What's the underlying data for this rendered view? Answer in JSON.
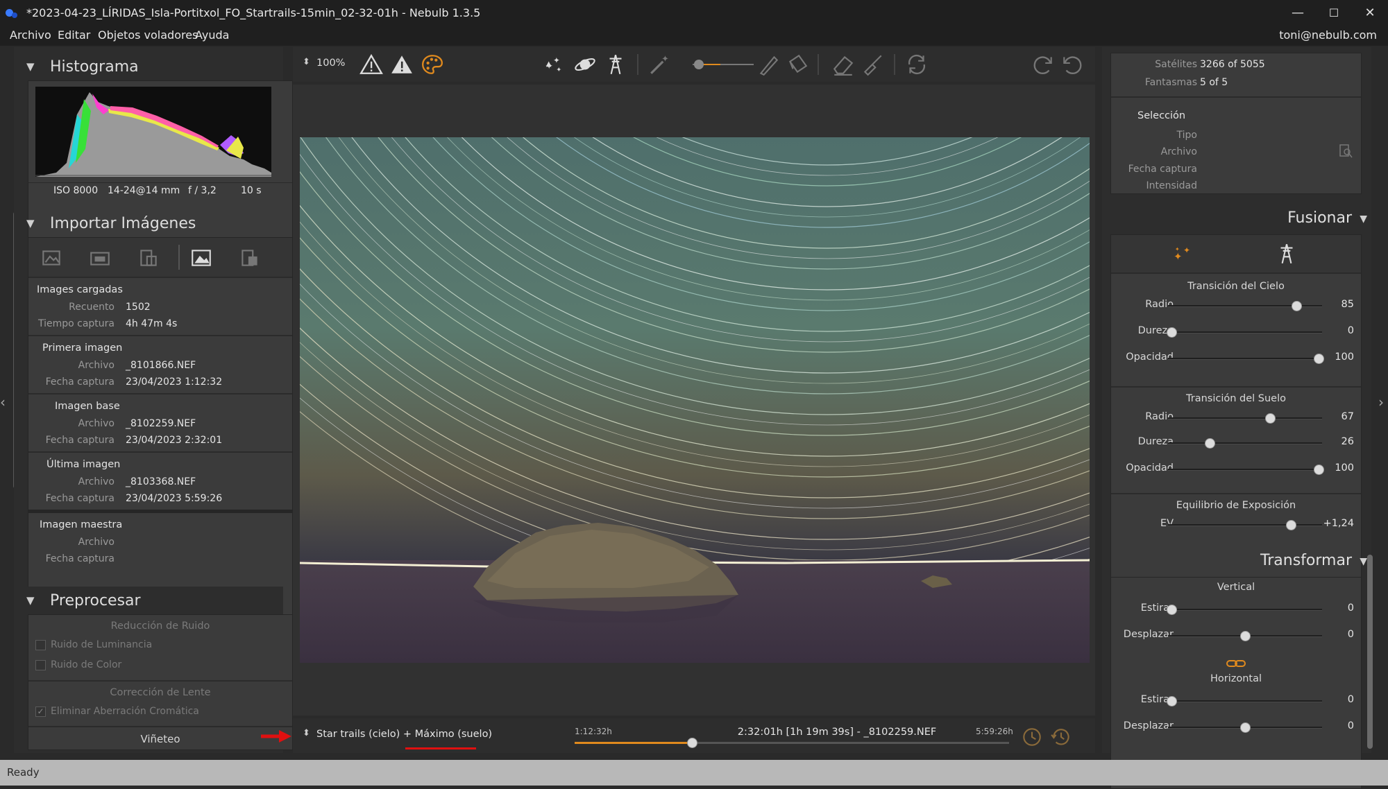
{
  "window": {
    "title": "*2023-04-23_LÍRIDAS_Isla-Portitxol_FO_Startrails-15min_02-32-01h - Nebulb 1.3.5",
    "controls": [
      "—",
      "☐",
      "✕"
    ]
  },
  "menubar": {
    "items": [
      "Archivo",
      "Editar",
      "Objetos voladores",
      "Ayuda"
    ],
    "user": "toni@nebulb.com"
  },
  "histogram": {
    "title": "Histograma",
    "iso": "ISO 8000",
    "lens": "14-24@14 mm",
    "aperture": "f / 3,2",
    "exposure": "10 s"
  },
  "import": {
    "title": "Importar Imágenes",
    "loaded": {
      "heading": "Images cargadas",
      "count_label": "Recuento",
      "count": "1502",
      "time_label": "Tiempo captura",
      "time": "4h 47m 4s"
    },
    "first": {
      "heading": "Primera imagen",
      "file_label": "Archivo",
      "file": "_8101866.NEF",
      "date_label": "Fecha captura",
      "date": "23/04/2023 1:12:32"
    },
    "base": {
      "heading": "Imagen base",
      "file_label": "Archivo",
      "file": "_8102259.NEF",
      "date_label": "Fecha captura",
      "date": "23/04/2023 2:32:01"
    },
    "last": {
      "heading": "Última imagen",
      "file_label": "Archivo",
      "file": "_8103368.NEF",
      "date_label": "Fecha captura",
      "date": "23/04/2023 5:59:26"
    },
    "master": {
      "heading": "Imagen maestra",
      "file_label": "Archivo",
      "date_label": "Fecha captura"
    }
  },
  "preprocess": {
    "title": "Preprocesar",
    "noise_heading": "Reducción de Ruido",
    "luminance": "Ruido de Luminancia",
    "color": "Ruido de Color",
    "lens_heading": "Corrección de Lente",
    "chromatic": "Eliminar Aberración Cromática",
    "vignette": "Viñeteo"
  },
  "toolbar": {
    "zoom": "100%"
  },
  "bottom": {
    "mode": "Star trails (cielo) + Máximo (suelo)",
    "start": "1:12:32h",
    "current": "2:32:01h [1h 19m 39s] - _8102259.NEF",
    "end": "5:59:26h",
    "timeline_position": 0.27
  },
  "info": {
    "satellites_label": "Satélites",
    "satellites": "3266 of 5055",
    "ghosts_label": "Fantasmas",
    "ghosts": "5 of 5",
    "selection_heading": "Selección",
    "type_label": "Tipo",
    "file_label": "Archivo",
    "date_label": "Fecha captura",
    "intensity_label": "Intensidad"
  },
  "merge": {
    "title": "Fusionar",
    "sky_heading": "Transición del Cielo",
    "sky": [
      {
        "label": "Radio",
        "value": "85",
        "pos": 0.85
      },
      {
        "label": "Dureza",
        "value": "0",
        "pos": 0.0
      },
      {
        "label": "Opacidad",
        "value": "100",
        "pos": 1.0
      }
    ],
    "ground_heading": "Transición del Suelo",
    "ground": [
      {
        "label": "Radio",
        "value": "67",
        "pos": 0.67
      },
      {
        "label": "Dureza",
        "value": "26",
        "pos": 0.26
      },
      {
        "label": "Opacidad",
        "value": "100",
        "pos": 1.0
      }
    ],
    "ev_heading": "Equilibrio de Exposición",
    "ev": {
      "label": "EV",
      "value": "+1,24",
      "pos": 0.81
    }
  },
  "transform": {
    "title": "Transformar",
    "vertical_heading": "Vertical",
    "vertical": [
      {
        "label": "Estirar",
        "value": "0",
        "pos": 0.0
      },
      {
        "label": "Desplazar",
        "value": "0",
        "pos": 0.5
      }
    ],
    "horizontal_heading": "Horizontal",
    "horizontal": [
      {
        "label": "Estirar",
        "value": "0",
        "pos": 0.0
      },
      {
        "label": "Desplazar",
        "value": "0",
        "pos": 0.5
      }
    ]
  },
  "status": "Ready",
  "colors": {
    "accent": "#e08a1e",
    "annotation": "#e01010"
  }
}
